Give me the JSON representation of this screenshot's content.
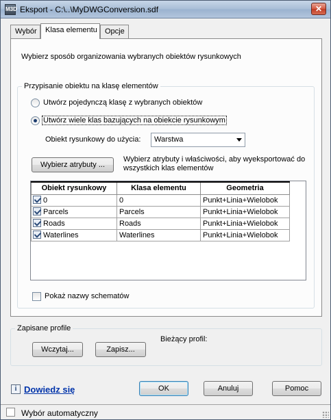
{
  "window": {
    "title": "Eksport - C:\\..\\MyDWGConversion.sdf",
    "icon_label": "M3D",
    "close_label": "✕"
  },
  "tabs": [
    {
      "label": "Wybór",
      "active": false
    },
    {
      "label": "Klasa elementu",
      "active": true
    },
    {
      "label": "Opcje",
      "active": false
    }
  ],
  "panel": {
    "instruction": "Wybierz sposób organizowania wybranych obiektów rysunkowych",
    "assignment_group": {
      "legend": "Przypisanie obiektu na klasę elementów",
      "radio_single": "Utwórz pojedynczą klasę z wybranych obiektów",
      "radio_multiple": "Utwórz wiele klas bazujących na obiekcie rysunkowym",
      "selected": "multiple",
      "object_label": "Obiekt rysunkowy do użycia:",
      "object_value": "Warstwa",
      "select_attrs_button": "Wybierz atrybuty ...",
      "select_attrs_desc_1": "Wybierz atrybuty i właściwości, aby wyeksportować do",
      "select_attrs_desc_2": "wszystkich klas elementów"
    },
    "grid": {
      "columns": [
        "Obiekt rysunkowy",
        "Klasa elementu",
        "Geometria"
      ],
      "rows": [
        {
          "object": "0",
          "class": "0",
          "geometry": "Punkt+Linia+Wielobok",
          "checked": true
        },
        {
          "object": "Parcels",
          "class": "Parcels",
          "geometry": "Punkt+Linia+Wielobok",
          "checked": true
        },
        {
          "object": "Roads",
          "class": "Roads",
          "geometry": "Punkt+Linia+Wielobok",
          "checked": true
        },
        {
          "object": "Waterlines",
          "class": "Waterlines",
          "geometry": "Punkt+Linia+Wielobok",
          "checked": true
        }
      ]
    },
    "show_schema_names": "Pokaż nazwy schematów"
  },
  "profiles": {
    "legend": "Zapisane profile",
    "load_button": "Wczytaj...",
    "save_button": "Zapisz...",
    "current_label": "Bieżący profil:"
  },
  "footer": {
    "learn_more": "Dowiedz się",
    "ok": "OK",
    "cancel": "Anuluj",
    "help": "Pomoc"
  },
  "status": {
    "text": "Wybór automatyczny"
  }
}
